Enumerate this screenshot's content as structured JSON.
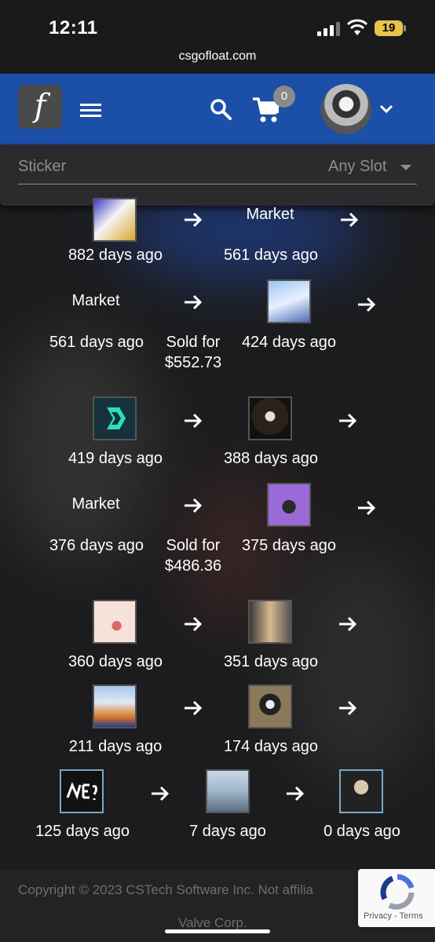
{
  "status": {
    "time": "12:11",
    "battery": "19"
  },
  "browser": {
    "url": "csgofloat.com"
  },
  "navbar": {
    "logo": "f",
    "cart_count": "0"
  },
  "filter": {
    "label": "Sticker",
    "slot": "Any Slot"
  },
  "history": [
    {
      "left": "882 days ago",
      "right": "561 days ago",
      "right_top": "Market"
    },
    {
      "left_top": "Market",
      "left": "561 days ago",
      "sold_label": "Sold for",
      "sold_price": "$552.73",
      "right": "424 days ago"
    },
    {
      "left": "419 days ago",
      "right": "388 days ago"
    },
    {
      "left_top": "Market",
      "left": "376 days ago",
      "sold_label": "Sold for",
      "sold_price": "$486.36",
      "right": "375 days ago"
    },
    {
      "left": "360 days ago",
      "right": "351 days ago"
    },
    {
      "left": "211 days ago",
      "right": "174 days ago"
    },
    {
      "left": "125 days ago",
      "middle": "7 days ago",
      "right": "0 days ago"
    }
  ],
  "footer": {
    "copyright": "Copyright © 2023 CSTech Software Inc. Not affilia",
    "valve": "Valve Corp.",
    "captcha": "Privacy - Terms"
  },
  "colors": {
    "navbar": "#1b4fa8",
    "panel": "#2b2b2d",
    "battery": "#e7c24d"
  }
}
